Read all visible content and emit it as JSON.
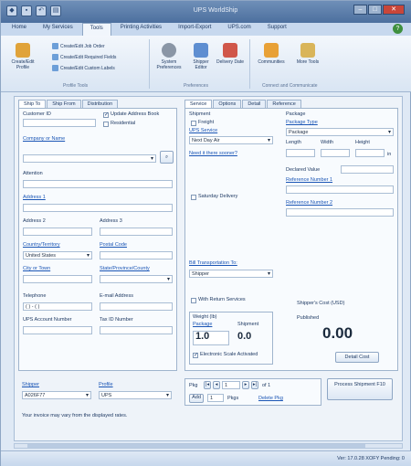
{
  "window": {
    "title": "UPS WorldShip"
  },
  "tabs": [
    "Home",
    "My Services",
    "Tools",
    "Printing Activities",
    "Import-Export",
    "UPS.com",
    "Support"
  ],
  "ribbon": {
    "create_edit_profile": "Create/Edit Profile",
    "create_edit_job_order": "Create/Edit Job Order",
    "create_edit_required_fields": "Create/Edit Required Fields",
    "create_edit_custom_labels": "Create/Edit Custom Labels",
    "profile_tools_label": "Profile Tools",
    "system_preferences": "System Preferences",
    "shipper_editor": "Shipper Editor",
    "delivery_date": "Delivery Date",
    "preferences_label": "Preferences",
    "communities": "Communities",
    "more_tools": "More Tools",
    "connect_label": "Connect and Communicate"
  },
  "left_tabs": [
    "Ship To",
    "Ship From",
    "Distribution"
  ],
  "ship_to": {
    "customer_id_label": "Customer ID",
    "update_address_book": "Update Address Book",
    "residential": "Residential",
    "company_label": "Company or Name",
    "attention_label": "Attention",
    "address1_label": "Address 1",
    "address2_label": "Address 2",
    "address3_label": "Address 3",
    "country_label": "Country/Territory",
    "country_value": "United States",
    "postal_label": "Postal Code",
    "city_label": "City or Town",
    "state_label": "State/Province/County",
    "telephone_label": "Telephone",
    "telephone_value": "( ) -  ( )",
    "email_label": "E-mail Address",
    "ups_account_label": "UPS Account Number",
    "tax_id_label": "Tax ID Number"
  },
  "right_tabs": [
    "Service",
    "Options",
    "Detail",
    "Reference"
  ],
  "service": {
    "shipment_label": "Shipment",
    "freight": "Freight",
    "ups_service_label": "UPS Service",
    "ups_service_value": "Next Day Air",
    "need_it_there": "Need it there sooner?",
    "saturday_delivery": "Saturday Delivery",
    "bill_transport_label": "Bill Transportation To:",
    "bill_transport_value": "Shipper",
    "return_services": "With Return Services"
  },
  "package": {
    "package_label": "Package",
    "package_type_label": "Package Type",
    "package_type_value": "Package",
    "length_label": "Length",
    "width_label": "Width",
    "height_label": "Height",
    "unit": "in",
    "declared_value_label": "Declared Value",
    "reference1_label": "Reference Number 1",
    "reference2_label": "Reference Number 2"
  },
  "weight": {
    "weight_label": "Weight (lb)",
    "package_label": "Package",
    "shipment_label": "Shipment",
    "package_value": "1.0",
    "shipment_value": "0.0",
    "scale_activated": "Electronic Scale Activated"
  },
  "cost": {
    "shippers_cost_label": "Shipper's Cost (USD)",
    "published_label": "Published",
    "amount": "0.00",
    "detail_cost_button": "Detail Cost"
  },
  "bottom": {
    "shipper_label": "Shipper",
    "shipper_value": "A026F77",
    "profile_label": "Profile",
    "profile_value": "UPS",
    "pkg_label": "Pkg",
    "pkg_current": "1",
    "pkg_of": "of 1",
    "add_label": "Add",
    "add_count": "1",
    "pkgs_label": "Pkgs",
    "delete_pkg": "Delete Pkg",
    "process_button": "Process Shipment F10"
  },
  "invoice_notice": "Your invoice may vary from the displayed rates.",
  "status_text": "Ver: 17.0.28 XOFY Pending: 0"
}
